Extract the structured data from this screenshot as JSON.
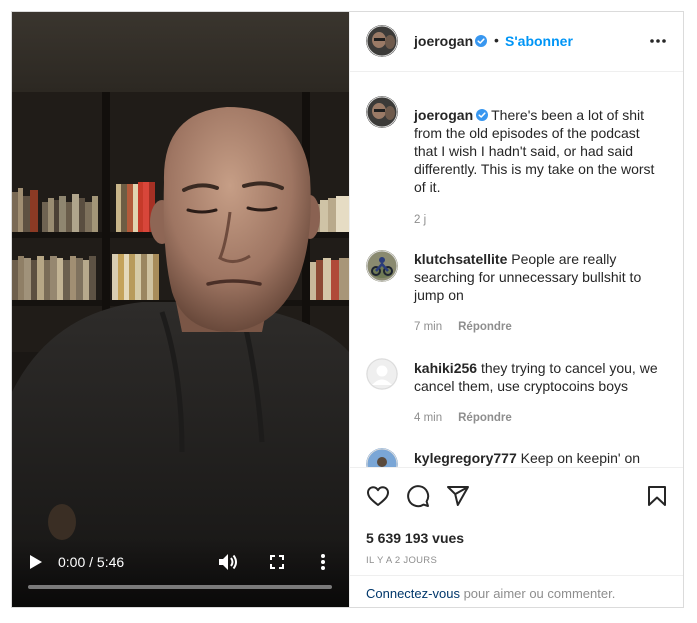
{
  "video": {
    "time": "0:00 / 5:46",
    "progress": 0
  },
  "post": {
    "username": "joerogan",
    "dot": "•",
    "follow_label": "S'abonner",
    "caption": "There's been a lot of shit from the old episodes of the podcast that I wish I hadn't said, or had said differently. This is my take on the worst of it.",
    "caption_age": "2 j",
    "views": "5 639 193 vues",
    "posted_ago": "IL Y A 2 JOURS"
  },
  "comments": [
    {
      "username": "klutchsatellite",
      "text": "People are really searching for unnecessary bullshit to jump on",
      "age": "7 min",
      "reply_label": "Répondre"
    },
    {
      "username": "kahiki256",
      "text": "they trying to cancel you, we cancel them, use cryptocoins boys",
      "age": "4 min",
      "reply_label": "Répondre"
    },
    {
      "username": "kylegregory777",
      "text": "Keep on keepin' on doll!",
      "age": "",
      "reply_label": ""
    }
  ],
  "footer": {
    "login_link": "Connectez-vous",
    "login_text": " pour aimer ou commenter."
  },
  "icons": {
    "verified": "verified-badge-icon",
    "more": "more-horizontal-icon",
    "like": "heart-icon",
    "comment": "comment-bubble-icon",
    "share": "paper-plane-icon",
    "save": "bookmark-icon",
    "play": "play-icon",
    "volume": "volume-icon",
    "fullscreen": "fullscreen-icon",
    "video_more": "more-vertical-icon"
  },
  "colors": {
    "accent": "#0095f6",
    "verified": "#3897f0",
    "text": "#262626",
    "muted": "#8e8e8e",
    "link_dark": "#00376b"
  }
}
